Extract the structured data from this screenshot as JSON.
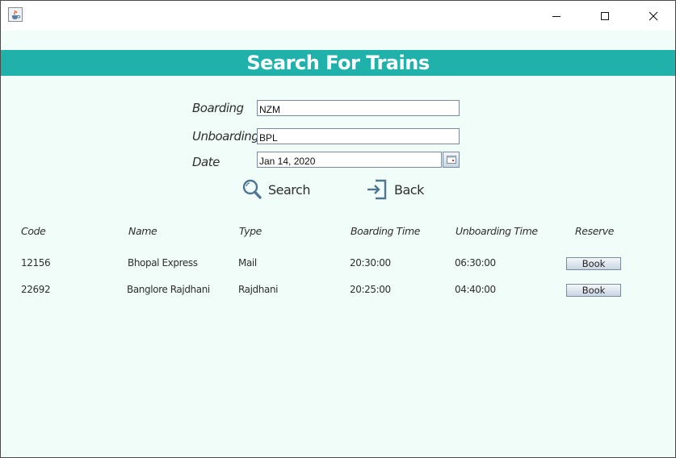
{
  "window": {
    "minimize_icon": "minimize-icon",
    "maximize_icon": "maximize-icon",
    "close_icon": "close-icon",
    "app_icon": "java-cup-icon"
  },
  "header": {
    "title": "Search For Trains",
    "color": "#20b2aa"
  },
  "form": {
    "boarding_label": "Boarding",
    "boarding_value": "NZM",
    "unboarding_label": "Unboarding",
    "unboarding_value": "BPL",
    "date_label": "Date",
    "date_value": "Jan 14, 2020"
  },
  "actions": {
    "search_label": "Search",
    "back_label": "Back",
    "search_icon": "search-icon",
    "back_icon": "exit-icon"
  },
  "table": {
    "columns": [
      "Code",
      "Name",
      "Type",
      "Boarding Time",
      "Unboarding Time",
      "Reserve"
    ],
    "rows": [
      {
        "code": "12156",
        "name": "Bhopal Express",
        "type": "Mail",
        "boarding": "20:30:00",
        "unboarding": "06:30:00",
        "reserve": "Book"
      },
      {
        "code": "22692",
        "name": "Banglore Rajdhani",
        "type": "Rajdhani",
        "boarding": "20:25:00",
        "unboarding": "04:40:00",
        "reserve": "Book"
      }
    ]
  }
}
